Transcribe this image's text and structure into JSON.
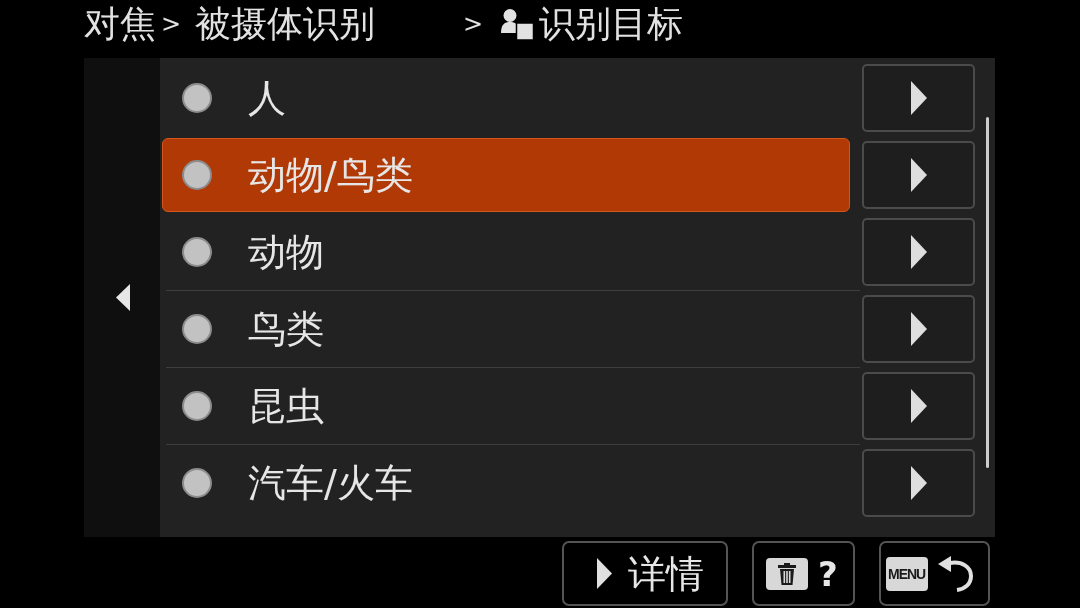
{
  "breadcrumb": {
    "path": [
      {
        "label": "对焦",
        "separator": ">"
      },
      {
        "label": "被摄体识别",
        "separator": ">"
      }
    ],
    "current": {
      "label": "识别目标"
    }
  },
  "list": {
    "items": [
      {
        "label": "人",
        "selected": false
      },
      {
        "label": "动物/鸟类",
        "selected": true
      },
      {
        "label": "动物",
        "selected": false
      },
      {
        "label": "鸟类",
        "selected": false
      },
      {
        "label": "昆虫",
        "selected": false
      },
      {
        "label": "汽车/火车",
        "selected": false
      }
    ]
  },
  "footer": {
    "buttons": [
      {
        "kind": "details",
        "label": "详情"
      },
      {
        "kind": "delete-help",
        "label": "?"
      },
      {
        "kind": "menu-back",
        "label": "MENU"
      }
    ]
  }
}
